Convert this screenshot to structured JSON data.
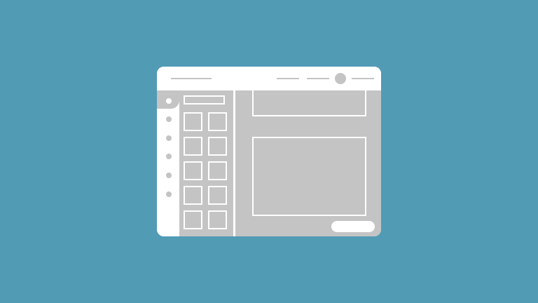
{
  "window": {
    "title": "",
    "nav_items": [
      "",
      "",
      ""
    ],
    "avatar_icon": "user-avatar-icon"
  },
  "rail": {
    "items": [
      {
        "icon": "rail-dot-icon",
        "active": true
      },
      {
        "icon": "rail-dot-icon",
        "active": false
      },
      {
        "icon": "rail-dot-icon",
        "active": false
      },
      {
        "icon": "rail-dot-icon",
        "active": false
      },
      {
        "icon": "rail-dot-icon",
        "active": false
      },
      {
        "icon": "rail-dot-icon",
        "active": false
      }
    ]
  },
  "panel": {
    "search_placeholder": "",
    "thumbnail_rows": 5,
    "thumbnail_cols": 2
  },
  "canvas": {
    "cards": [
      "top-card",
      "main-card"
    ],
    "action_label": ""
  },
  "colors": {
    "background": "#519bb5",
    "window": "#ffffff",
    "placeholder": "#c4c4c4"
  }
}
